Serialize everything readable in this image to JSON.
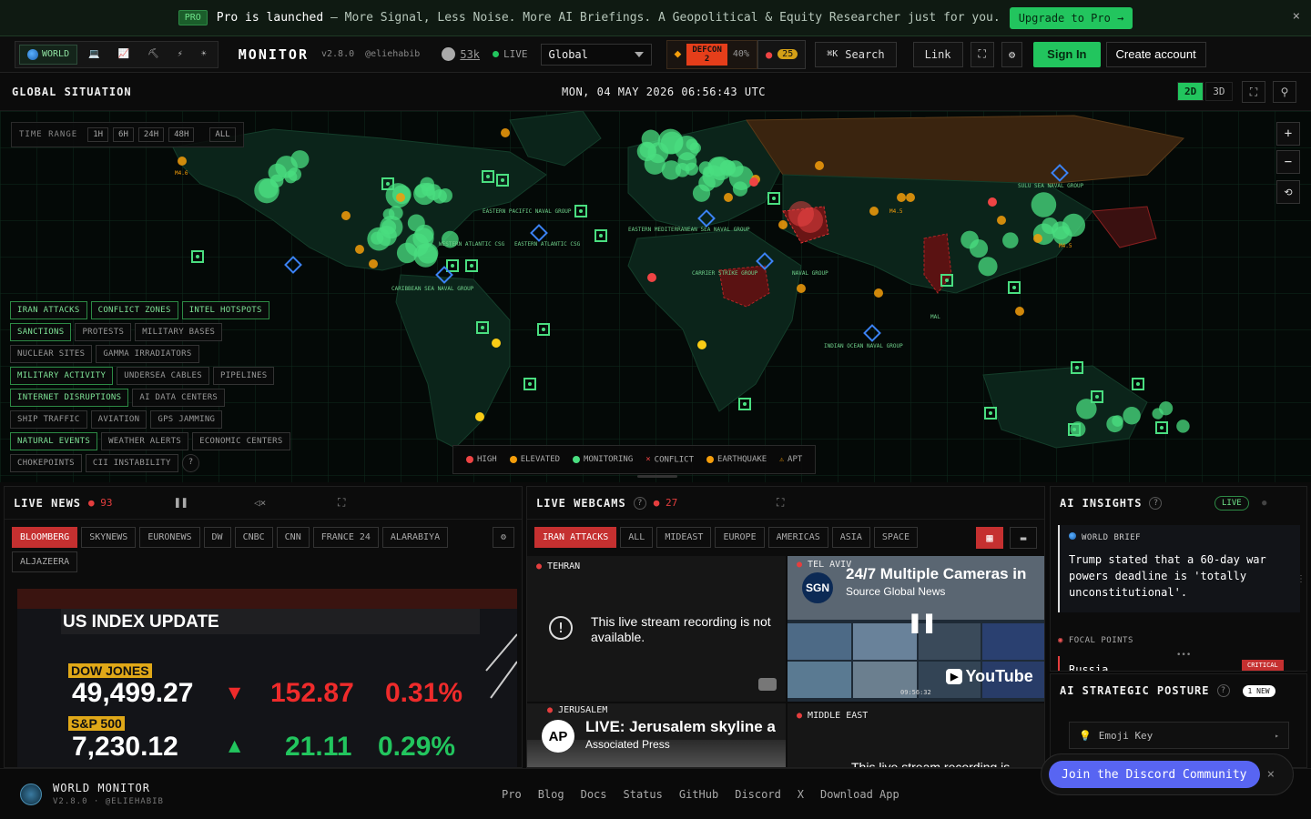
{
  "promo": {
    "badge": "PRO",
    "headline_bold": "Pro is launched",
    "headline_rest": " — More Signal, Less Noise. More AI Briefings. A Geopolitical & Equity Researcher just for you.",
    "cta": "Upgrade to Pro →",
    "close": "×"
  },
  "header": {
    "variant_tabs": [
      "WORLD",
      "💻",
      "📈",
      "⛏",
      "⚡",
      "☀"
    ],
    "brand": "MONITOR",
    "version": "v2.8.0",
    "handle": "@eliehabib",
    "github_stars": "53k",
    "live": "LIVE",
    "region": "Global",
    "defcon_label": "DEFCON",
    "defcon_level": "2",
    "defcon_pct": "40%",
    "alerts_count": "25",
    "search_key": "⌘K",
    "search_label": "Search",
    "link_label": "Link",
    "sign_in": "Sign In",
    "create_account": "Create account"
  },
  "mapbar": {
    "title": "GLOBAL SITUATION",
    "clock": "MON, 04 MAY 2026 06:56:43 UTC",
    "mode_2d": "2D",
    "mode_3d": "3D"
  },
  "map": {
    "time_range_label": "TIME RANGE",
    "time_ranges": [
      "1H",
      "6H",
      "24H",
      "48H",
      "ALL"
    ],
    "layer_rows": [
      [
        {
          "label": "IRAN ATTACKS",
          "on": true
        },
        {
          "label": "CONFLICT ZONES",
          "on": true
        },
        {
          "label": "INTEL HOTSPOTS",
          "on": true
        }
      ],
      [
        {
          "label": "SANCTIONS",
          "on": true
        },
        {
          "label": "PROTESTS",
          "on": false
        },
        {
          "label": "MILITARY BASES",
          "on": false
        }
      ],
      [
        {
          "label": "NUCLEAR SITES",
          "on": false
        },
        {
          "label": "GAMMA IRRADIATORS",
          "on": false
        }
      ],
      [
        {
          "label": "MILITARY ACTIVITY",
          "on": true
        },
        {
          "label": "UNDERSEA CABLES",
          "on": false
        },
        {
          "label": "PIPELINES",
          "on": false
        }
      ],
      [
        {
          "label": "INTERNET DISRUPTIONS",
          "on": true
        },
        {
          "label": "AI DATA CENTERS",
          "on": false
        }
      ],
      [
        {
          "label": "SHIP TRAFFIC",
          "on": false
        },
        {
          "label": "AVIATION",
          "on": false
        },
        {
          "label": "GPS JAMMING",
          "on": false
        }
      ],
      [
        {
          "label": "NATURAL EVENTS",
          "on": true
        },
        {
          "label": "WEATHER ALERTS",
          "on": false
        },
        {
          "label": "ECONOMIC CENTERS",
          "on": false
        }
      ],
      [
        {
          "label": "CHOKEPOINTS",
          "on": false
        },
        {
          "label": "CII INSTABILITY",
          "on": false
        },
        {
          "label": "?",
          "on": false
        }
      ]
    ],
    "legend": [
      {
        "label": "HIGH",
        "color": "#ef4444"
      },
      {
        "label": "ELEVATED",
        "color": "#f59e0b"
      },
      {
        "label": "MONITORING",
        "color": "#4ade80"
      },
      {
        "label": "CONFLICT",
        "color": "#ef4444"
      },
      {
        "label": "EARTHQUAKE",
        "color": "#f59e0b"
      },
      {
        "label": "APT",
        "color": "#f59e0b"
      }
    ],
    "labels": [
      "EASTERN PACIFIC NAVAL GROUP",
      "WESTERN ATLANTIC CSG",
      "EASTERN ATLANTIC CSG",
      "EASTERN MEDITERRANEAN SEA NAVAL GROUP",
      "CARRIER STRIKE GROUP",
      "NAVAL GROUP",
      "CARIBBEAN SEA NAVAL GROUP",
      "INDIAN OCEAN NAVAL GROUP",
      "SULU SEA NAVAL GROUP",
      "M4.6",
      "M4.5",
      "M4.5",
      "MAL"
    ]
  },
  "live_news": {
    "title": "LIVE NEWS",
    "count": "93",
    "channels": [
      "BLOOMBERG",
      "SKYNEWS",
      "EURONEWS",
      "DW",
      "CNBC",
      "CNN",
      "FRANCE 24",
      "ALARABIYA",
      "ALJAZEERA"
    ],
    "active": "BLOOMBERG",
    "screen": {
      "headline": "US INDEX UPDATE",
      "rows": [
        {
          "name": "DOW JONES",
          "value": "49,499.27",
          "change": "152.87",
          "pct": "0.31%",
          "dir": "down"
        },
        {
          "name": "S&P 500",
          "value": "7,230.12",
          "change": "21.11",
          "pct": "0.29%",
          "dir": "up"
        }
      ]
    }
  },
  "webcams": {
    "title": "LIVE WEBCAMS",
    "count": "27",
    "filters": [
      "IRAN ATTACKS",
      "ALL",
      "MIDEAST",
      "EUROPE",
      "AMERICAS",
      "ASIA",
      "SPACE"
    ],
    "active": "IRAN ATTACKS",
    "cams": [
      {
        "city": "TEHRAN",
        "message": "This live stream recording is not available."
      },
      {
        "city": "TEL AVIV",
        "video_title": "24/7 Multiple Cameras in",
        "source": "Source Global News",
        "badge": "SGN",
        "time": "09:56:32",
        "yt": "YouTube"
      },
      {
        "city": "JERUSALEM",
        "video_title": "LIVE: Jerusalem skyline a",
        "source": "Associated Press",
        "badge": "AP"
      },
      {
        "city": "MIDDLE EAST",
        "message": "This live stream recording is"
      }
    ]
  },
  "insights": {
    "title": "AI INSIGHTS",
    "live": "LIVE",
    "brief_label": "WORLD BRIEF",
    "brief_text": "Trump stated that a 60-day war powers deadline is 'totally unconstitutional'.",
    "focal_label": "FOCAL POINTS",
    "focal_first": "Russia",
    "focal_tag": "CRITICAL"
  },
  "posture": {
    "title": "AI STRATEGIC POSTURE",
    "badge": "1 NEW",
    "emoji_key": "Emoji Key"
  },
  "discord": {
    "label": "Join the Discord Community",
    "close": "×"
  },
  "footer": {
    "name": "WORLD MONITOR",
    "sub": "V2.8.0 · @ELIEHABIB",
    "links": [
      "Pro",
      "Blog",
      "Docs",
      "Status",
      "GitHub",
      "Discord",
      "X",
      "Download App"
    ]
  }
}
